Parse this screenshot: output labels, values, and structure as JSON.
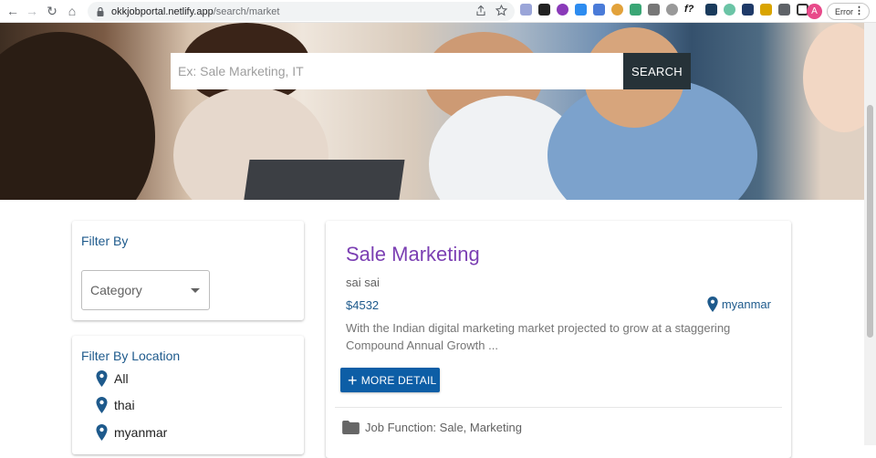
{
  "browser": {
    "url_domain": "okkjobportal.netlify.app",
    "url_path": "/search/market",
    "profile_initial": "A",
    "error_label": "Error"
  },
  "search": {
    "placeholder": "Ex: Sale Marketing, IT",
    "button_label": "SEARCH"
  },
  "filter": {
    "title": "Filter By",
    "category_label": "Category"
  },
  "location_filter": {
    "title": "Filter By Location",
    "items": [
      "All",
      "thai",
      "myanmar"
    ]
  },
  "job": {
    "title": "Sale Marketing",
    "company": "sai sai",
    "salary": "$4532",
    "location": "myanmar",
    "description": "With the Indian digital marketing market projected to grow at a staggering Compound Annual Growth ...",
    "detail_button": "MORE DETAIL",
    "job_function": "Job Function: Sale, Marketing"
  },
  "colors": {
    "accent_blue": "#1e5a8c",
    "title_purple": "#7b3fb3",
    "button_blue": "#0d5ea6",
    "search_button": "#263238"
  }
}
